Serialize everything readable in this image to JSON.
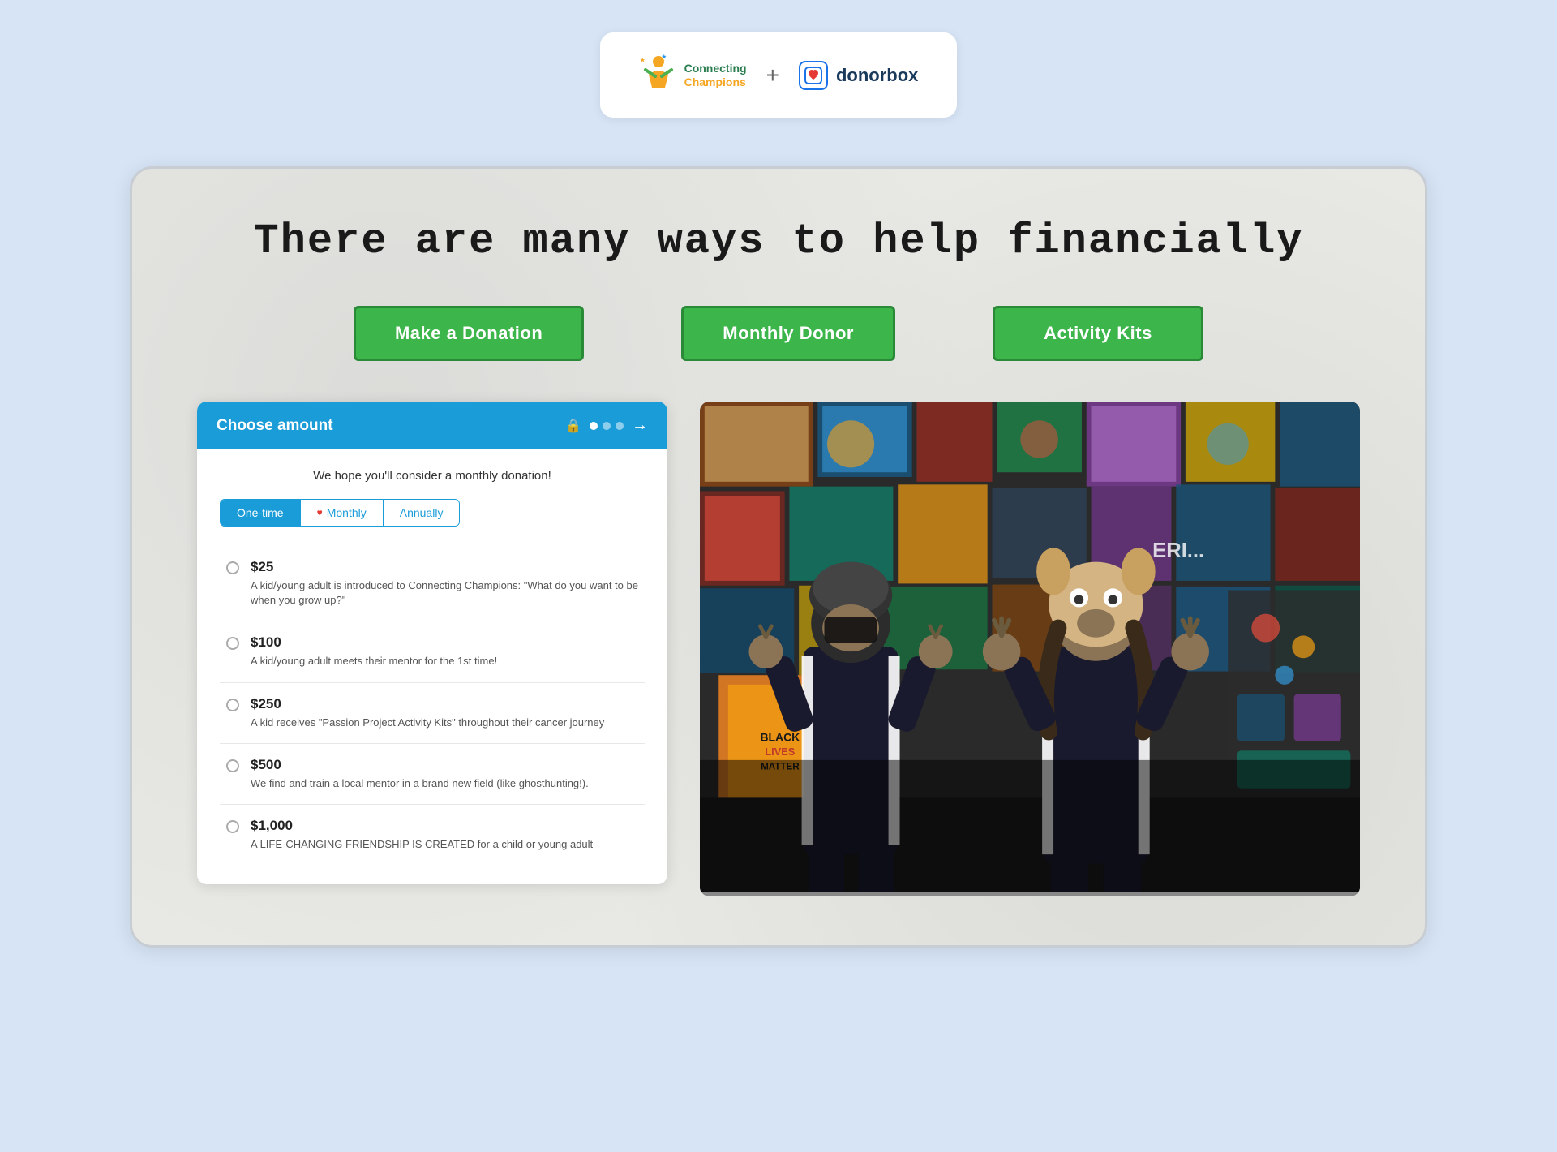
{
  "logo": {
    "connecting_champions": {
      "line1": "Connecting",
      "line2": "Champions"
    },
    "plus": "+",
    "donorbox": "donorbox"
  },
  "page": {
    "title": "There are many ways to help financially"
  },
  "buttons": {
    "make_donation": "Make a Donation",
    "monthly_donor": "Monthly Donor",
    "activity_kits": "Activity Kits"
  },
  "widget": {
    "header": "Choose amount",
    "tagline": "We hope you'll consider a monthly donation!",
    "tabs": {
      "one_time": "One-time",
      "monthly": "Monthly",
      "annually": "Annually"
    },
    "options": [
      {
        "amount": "$25",
        "description": "A kid/young adult is introduced to Connecting Champions: \"What do you want to be when you grow up?\""
      },
      {
        "amount": "$100",
        "description": "A kid/young adult meets their mentor for the 1st time!"
      },
      {
        "amount": "$250",
        "description": "A kid receives \"Passion Project Activity Kits\" throughout their cancer journey"
      },
      {
        "amount": "$500",
        "description": "We find and train a local mentor in a brand new field (like ghosthunting!)."
      },
      {
        "amount": "$1,000",
        "description": "A LIFE-CHANGING FRIENDSHIP IS CREATED for a child or young adult"
      }
    ]
  },
  "colors": {
    "green_btn": "#3cb54a",
    "header_blue": "#1a9cd8",
    "bg_card": "#e8e8e4",
    "bg_page": "#d6e4f5"
  }
}
